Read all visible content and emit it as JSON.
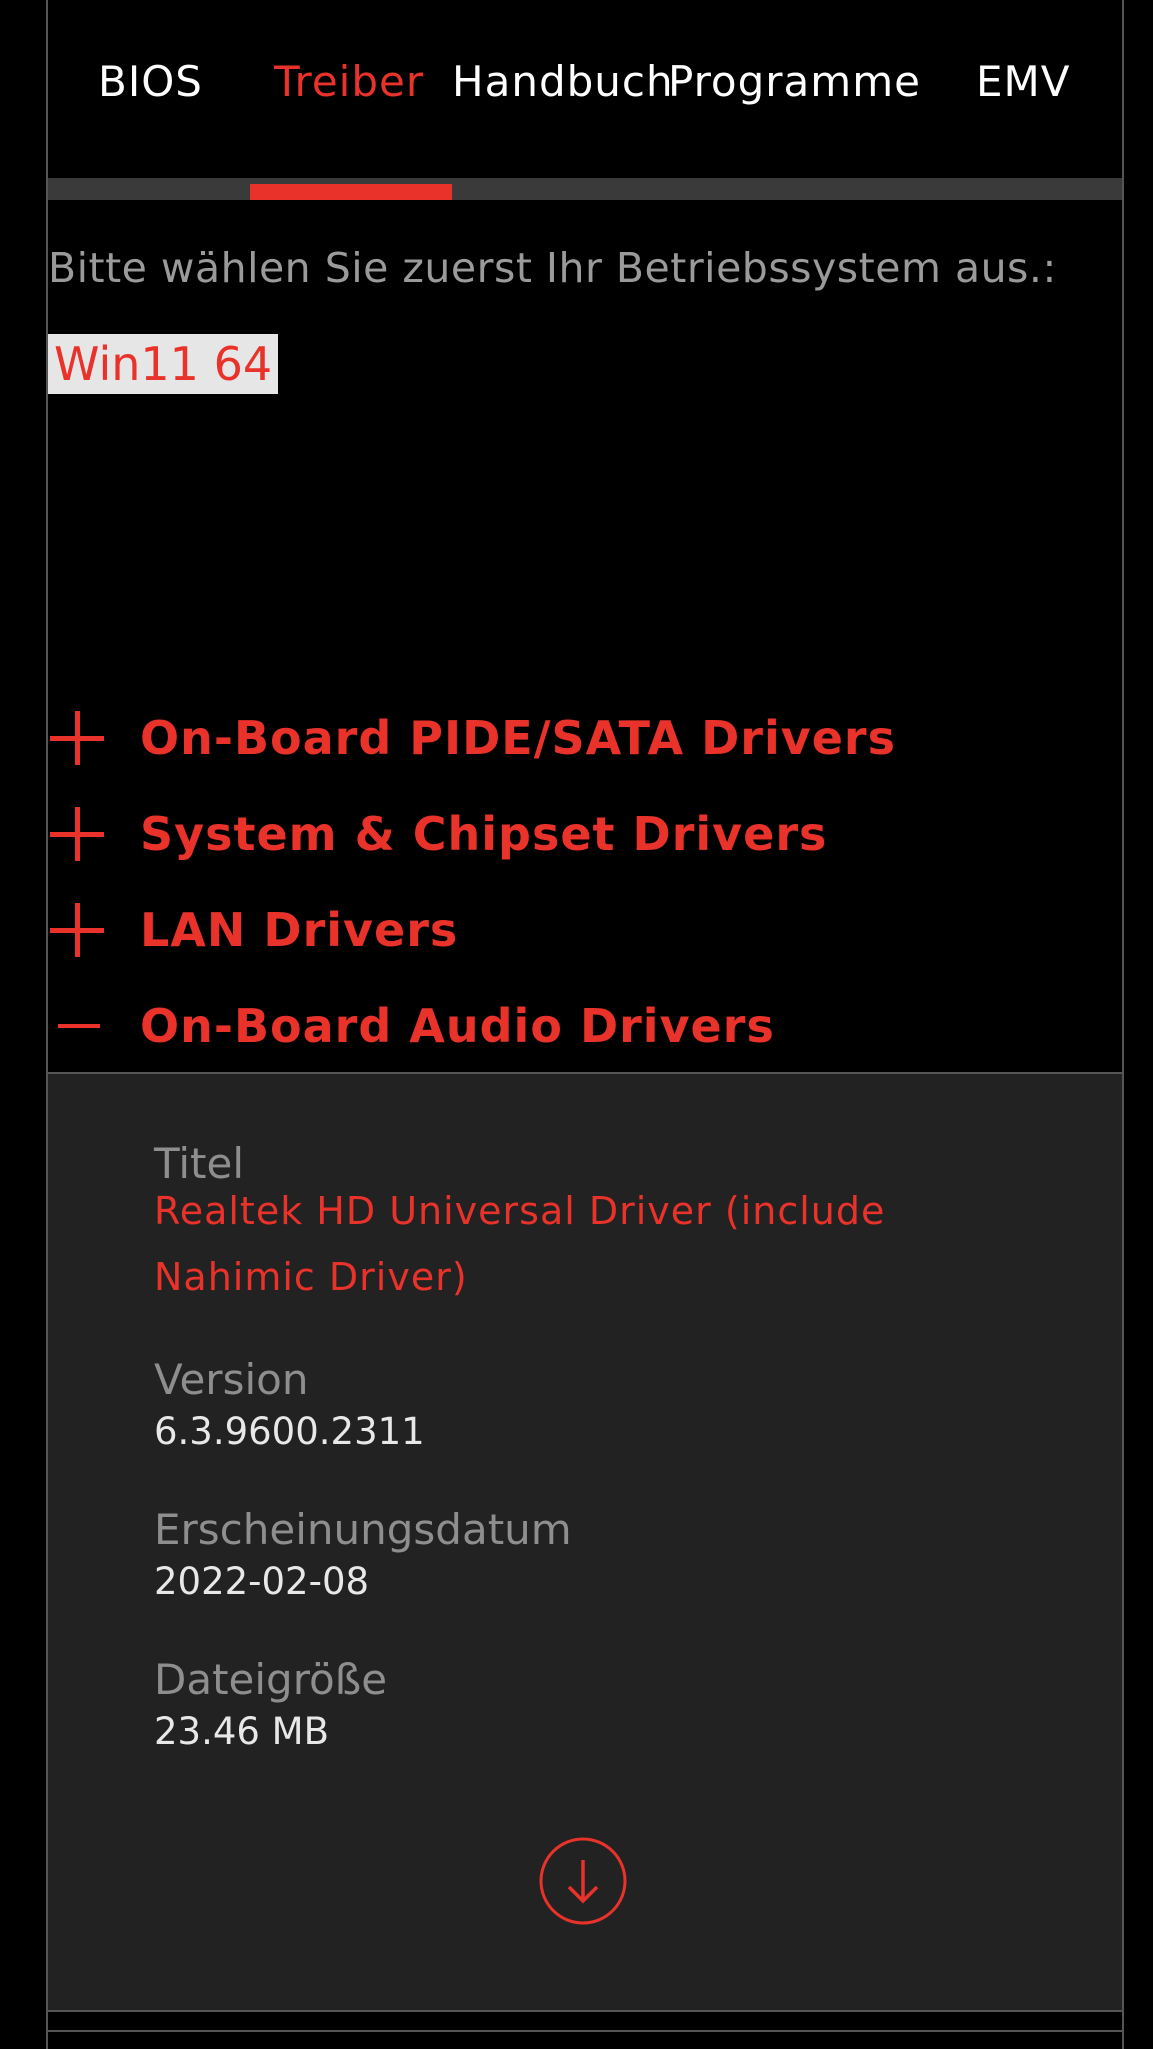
{
  "colors": {
    "accent": "#e8322a",
    "background": "#000000",
    "panel": "#222222"
  },
  "tabs": [
    {
      "label": "BIOS",
      "active": false
    },
    {
      "label": "Treiber",
      "active": true
    },
    {
      "label": "Handbuch",
      "active": false
    },
    {
      "label": "Programme",
      "active": false
    },
    {
      "label": "EMV",
      "active": false
    }
  ],
  "os": {
    "prompt": "Bitte wählen Sie zuerst Ihr Betriebssystem aus.:",
    "selected": "Win11 64"
  },
  "categories": [
    {
      "label": "On-Board PIDE/SATA Drivers",
      "expanded": false,
      "icon": "plus-icon"
    },
    {
      "label": "System & Chipset Drivers",
      "expanded": false,
      "icon": "plus-icon"
    },
    {
      "label": "LAN Drivers",
      "expanded": false,
      "icon": "plus-icon"
    },
    {
      "label": "On-Board Audio Drivers",
      "expanded": true,
      "icon": "minus-icon"
    }
  ],
  "driver": {
    "title_label": "Titel",
    "title": "Realtek HD Universal Driver (include Nahimic Driver)",
    "version_label": "Version",
    "version": "6.3.9600.2311",
    "date_label": "Erscheinungsdatum",
    "date": "2022-02-08",
    "size_label": "Dateigröße",
    "size": "23.46 MB",
    "download_icon": "download-icon"
  }
}
